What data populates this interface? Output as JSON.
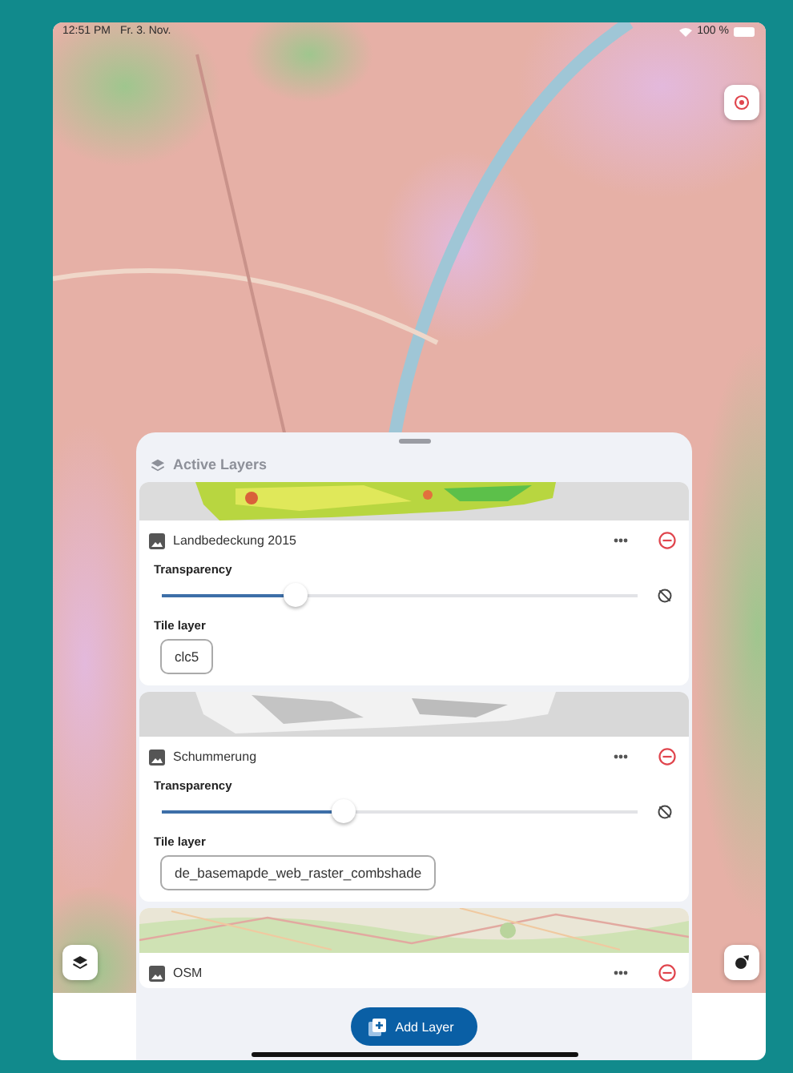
{
  "status_bar": {
    "time": "12:51 PM",
    "date": "Fr. 3. Nov.",
    "battery": "100 %"
  },
  "sheet": {
    "title": "Active Layers"
  },
  "layers": [
    {
      "name": "Landbedeckung 2015",
      "transparency_label": "Transparency",
      "level": 0.28,
      "tile_label": "Tile layer",
      "tile_layer": "clc5"
    },
    {
      "name": "Schummerung",
      "transparency_label": "Transparency",
      "level": 0.38,
      "tile_label": "Tile layer",
      "tile_layer": "de_basemapde_web_raster_combshade"
    },
    {
      "name": "OSM"
    }
  ],
  "add_button": "Add Layer"
}
